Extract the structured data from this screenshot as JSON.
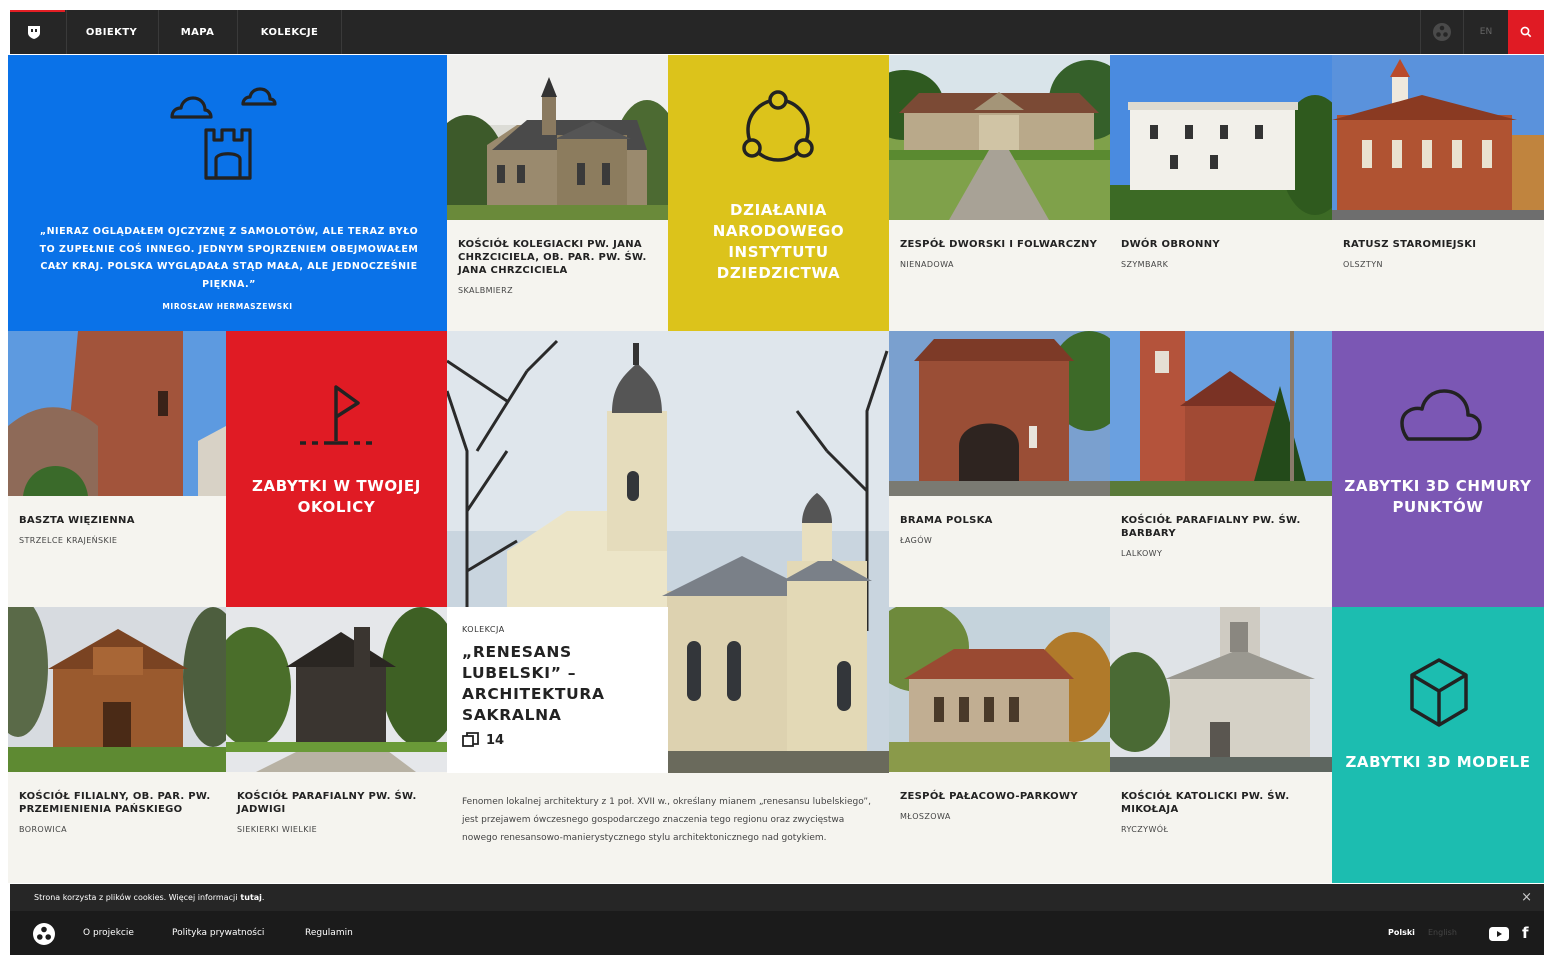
{
  "nav": {
    "items": [
      {
        "label": "OBIEKTY"
      },
      {
        "label": "MAPA"
      },
      {
        "label": "KOLEKCJE"
      }
    ],
    "lang": "EN"
  },
  "quote": {
    "text": "„NIERAZ OGLĄDAŁEM OJCZYZNĘ Z SAMOLOTÓW, ALE TERAZ BYŁO TO ZUPEŁNIE COŚ INNEGO. JEDNYM SPOJRZENIEM OBEJMOWAŁEM CAŁY KRAJ. POLSKA WYGLĄDAŁA STĄD MAŁA, ALE JEDNOCZEŚNIE PIĘKNA.”",
    "author": "MIROSŁAW HERMASZEWSKI"
  },
  "tiles": {
    "skalbmierz": {
      "title": "KOŚCIÓŁ KOLEGIACKI PW. JANA CHRZCICIELA, OB. PAR. PW. ŚW. JANA CHRZCICIELA",
      "place": "SKALBMIERZ"
    },
    "dzialania": {
      "title": "DZIAŁANIA NARODOWEGO INSTYTUTU DZIEDZICTWA"
    },
    "nienadowa": {
      "title": "ZESPÓŁ DWORSKI I FOLWARCZNY",
      "place": "NIENADOWA"
    },
    "szymbark": {
      "title": "DWÓR OBRONNY",
      "place": "SZYMBARK"
    },
    "olsztyn": {
      "title": "RATUSZ STAROMIEJSKI",
      "place": "OLSZTYN"
    },
    "strzelce": {
      "title": "BASZTA WIĘZIENNA",
      "place": "STRZELCE KRAJEŃSKIE"
    },
    "okolica": {
      "title": "ZABYTKI W TWOJEJ OKOLICY"
    },
    "lagow": {
      "title": "BRAMA POLSKA",
      "place": "ŁAGÓW"
    },
    "lalkowy": {
      "title": "KOŚCIÓŁ PARAFIALNY PW. ŚW. BARBARY",
      "place": "LALKOWY"
    },
    "chmury": {
      "title": "ZABYTKI 3D CHMURY PUNKTÓW"
    },
    "borowica": {
      "title": "KOŚCIÓŁ FILIALNY, OB. PAR. PW. PRZEMIENIENIA PAŃSKIEGO",
      "place": "BOROWICA"
    },
    "siekierki": {
      "title": "KOŚCIÓŁ PARAFIALNY PW. ŚW. JADWIGI",
      "place": "SIEKIERKI WIELKIE"
    },
    "mloszowa": {
      "title": "ZESPÓŁ PAŁACOWO-PARKOWY",
      "place": "MŁOSZOWA"
    },
    "ryczywol": {
      "title": "KOŚCIÓŁ KATOLICKI PW. ŚW. MIKOŁAJA",
      "place": "RYCZYWÓŁ"
    },
    "modele": {
      "title": "ZABYTKI 3D MODELE"
    }
  },
  "collection": {
    "kicker": "KOLEKCJA",
    "title": "„RENESANS LUBELSKI” – ARCHITEKTURA SAKRALNA",
    "count": "14",
    "description": "Fenomen lokalnej architektury z 1 poł. XVII w., określany mianem „renesansu lubelskiego”, jest przejawem ówczesnego gospodarczego znaczenia tego regionu oraz zwycięstwa nowego renesansowo-manierystycznego stylu architektonicznego nad gotykiem."
  },
  "cookie": {
    "text": "Strona korzysta z plików cookies. Więcej informacji ",
    "link": "tutaj",
    "after": "."
  },
  "footer": {
    "links": [
      "O projekcie",
      "Polityka prywatności",
      "Regulamin"
    ],
    "lang_active": "Polski",
    "lang_other": "English"
  },
  "colors": {
    "blue": "#0a72e8",
    "yellow": "#dcc31b",
    "red": "#e01b24",
    "purple": "#7b57b4",
    "teal": "#1cbdb0",
    "dark": "#262626"
  }
}
